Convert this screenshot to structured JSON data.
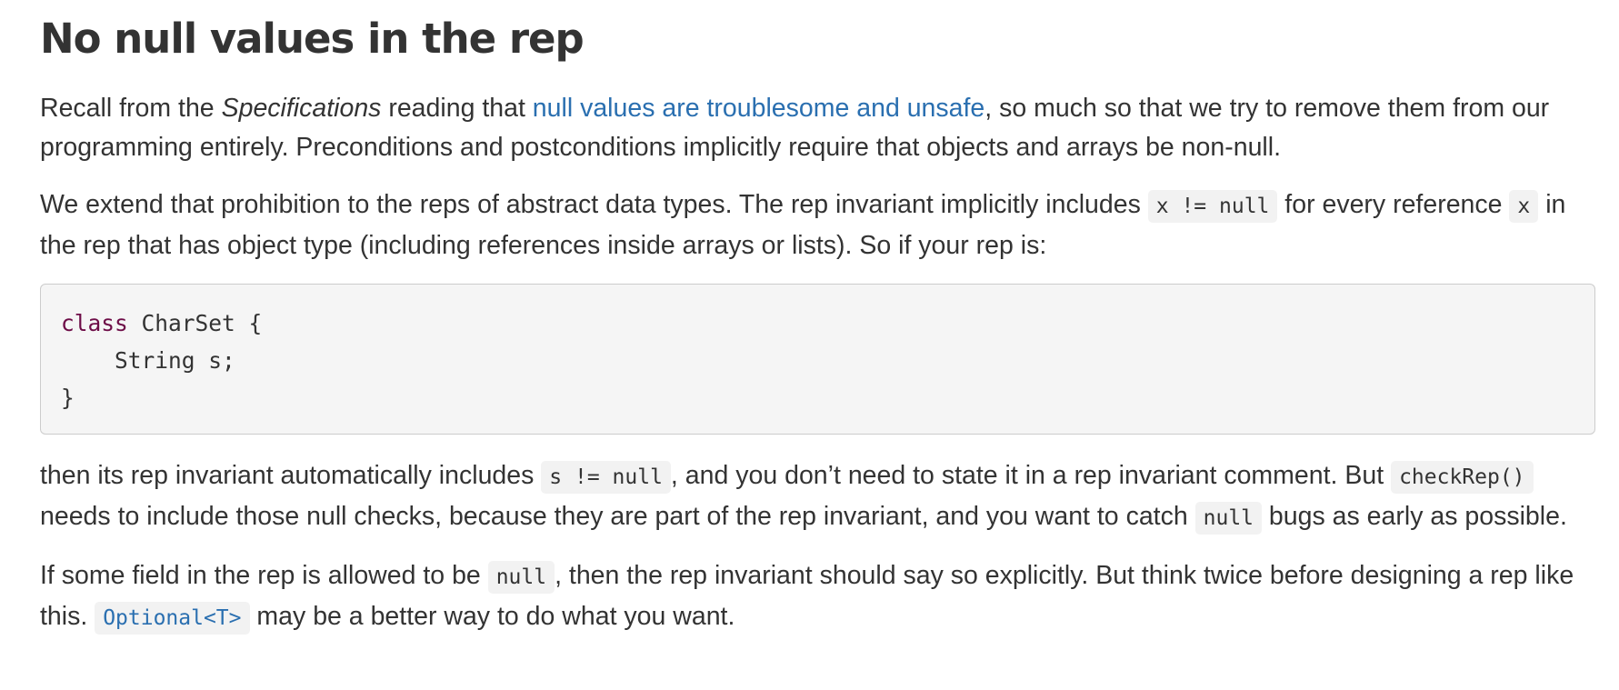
{
  "heading": "No null values in the rep",
  "p1": {
    "t1": "Recall from the ",
    "em": "Specifications",
    "t2": " reading that ",
    "link": "null values are troublesome and unsafe",
    "t3": ", so much so that we try to remove them from our programming entirely. Preconditions and postconditions implicitly require that objects and arrays be non-null."
  },
  "p2": {
    "t1": "We extend that prohibition to the reps of abstract data types. The rep invariant implicitly includes ",
    "c1": "x != null",
    "t2": " for every reference ",
    "c2": "x",
    "t3": " in the rep that has object type (including references inside arrays or lists). So if your rep is:"
  },
  "code_block": {
    "line1_kw": "class",
    "line1_rest": " CharSet {",
    "line2": "    String s;",
    "line3": "}"
  },
  "p3": {
    "t1": "then its rep invariant automatically includes ",
    "c1": "s != null",
    "t2": ", and you don’t need to state it in a rep invariant comment. But ",
    "c2": "checkRep()",
    "t3": " needs to include those null checks, because they are part of the rep invariant, and you want to catch ",
    "c3": "null",
    "t4": " bugs as early as possible."
  },
  "p4": {
    "t1": "If some field in the rep is allowed to be ",
    "c1": "null",
    "t2": ", then the rep invariant should say so explicitly. But think twice before designing a rep like this. ",
    "c2": "Optional<T>",
    "t3": " may be a better way to do what you want."
  },
  "colors": {
    "link": "#2a6fb0",
    "keyword": "#6d0c47",
    "text": "#333333",
    "code_bg": "#f5f5f5"
  }
}
